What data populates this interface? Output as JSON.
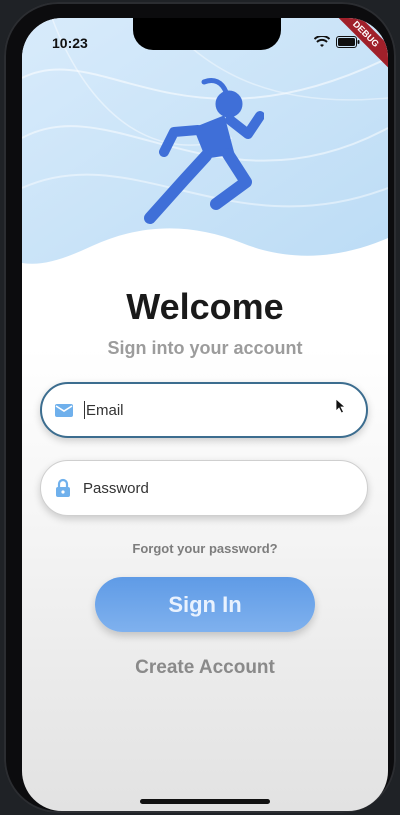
{
  "status_bar": {
    "time": "10:23",
    "debug_label": "DEBUG"
  },
  "login": {
    "title": "Welcome",
    "subtitle": "Sign into your account",
    "email_placeholder": "Email",
    "password_placeholder": "Password",
    "forgot_label": "Forgot your password?",
    "signin_label": "Sign In",
    "create_label": "Create Account"
  },
  "icons": {
    "email": "mail-icon",
    "password": "lock-icon",
    "logo": "runner-icon"
  },
  "colors": {
    "accent": "#5f9be6",
    "runner": "#3f6fd8",
    "email_border": "#3c6d8f",
    "muted_text": "#9c9c9c"
  }
}
